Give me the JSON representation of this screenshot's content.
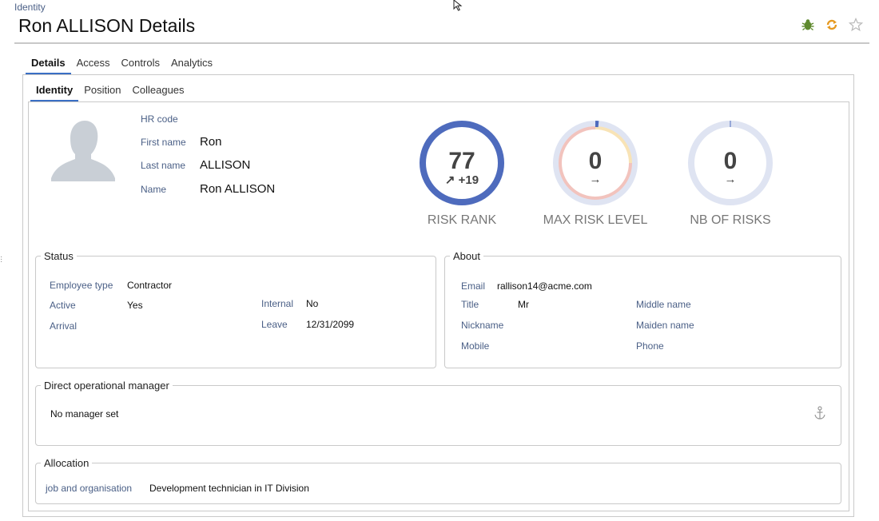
{
  "breadcrumb": "Identity",
  "title": "Ron ALLISON Details",
  "header_icons": [
    "bug-icon",
    "sync-icon",
    "star-icon"
  ],
  "tabs": [
    {
      "label": "Details",
      "active": true
    },
    {
      "label": "Access",
      "active": false
    },
    {
      "label": "Controls",
      "active": false
    },
    {
      "label": "Analytics",
      "active": false
    }
  ],
  "subtabs": [
    {
      "label": "Identity",
      "active": true
    },
    {
      "label": "Position",
      "active": false
    },
    {
      "label": "Colleagues",
      "active": false
    }
  ],
  "identity": {
    "hr_code_label": "HR code",
    "hr_code_value": "",
    "first_name_label": "First name",
    "first_name_value": "Ron",
    "last_name_label": "Last name",
    "last_name_value": "ALLISON",
    "name_label": "Name",
    "name_value": "Ron ALLISON"
  },
  "gauges": [
    {
      "label": "RISK RANK",
      "value": "77",
      "delta": "+19",
      "trend": "up-right",
      "color": "#4e6bbd"
    },
    {
      "label": "MAX RISK LEVEL",
      "value": "0",
      "trend": "right",
      "color": "#4e6bbd"
    },
    {
      "label": "NB OF RISKS",
      "value": "0",
      "trend": "right",
      "color": "#4e6bbd"
    }
  ],
  "status": {
    "legend": "Status",
    "employee_type_label": "Employee type",
    "employee_type_value": "Contractor",
    "active_label": "Active",
    "active_value": "Yes",
    "arrival_label": "Arrival",
    "arrival_value": "",
    "internal_label": "Internal",
    "internal_value": "No",
    "leave_label": "Leave",
    "leave_value": "12/31/2099"
  },
  "about": {
    "legend": "About",
    "email_label": "Email",
    "email_value": "rallison14@acme.com",
    "title_label": "Title",
    "title_value": "Mr",
    "nickname_label": "Nickname",
    "mobile_label": "Mobile",
    "middle_name_label": "Middle name",
    "maiden_name_label": "Maiden name",
    "phone_label": "Phone"
  },
  "manager": {
    "legend": "Direct operational manager",
    "text": "No manager set"
  },
  "allocation": {
    "legend": "Allocation",
    "label": "job and organisation",
    "value": "Development technician in IT Division"
  }
}
